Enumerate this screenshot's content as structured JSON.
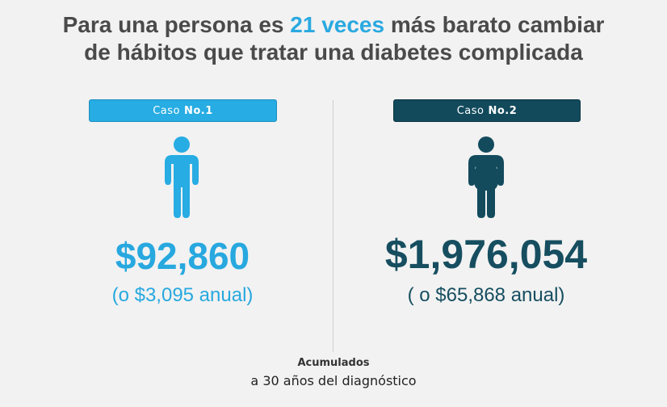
{
  "title": {
    "line1_pre": "Para una persona es ",
    "line1_highlight": "21 veces",
    "line1_post": " más barato cambiar",
    "line2": "de hábitos que tratar una diabetes complicada"
  },
  "cases": [
    {
      "label_prefix": "Caso",
      "label_number": "No.1",
      "icon": "person-slim-icon",
      "amount": "$92,860",
      "annual": "(o $3,095 anual)",
      "color": "#27a8df"
    },
    {
      "label_prefix": "Caso",
      "label_number": "No.2",
      "icon": "person-heavy-icon",
      "amount": "$1,976,054",
      "annual": "( o $65,868 anual)",
      "color": "#164e60"
    }
  ],
  "footer": {
    "line1": "Acumulados",
    "line2": "a 30 años del diagnóstico"
  }
}
